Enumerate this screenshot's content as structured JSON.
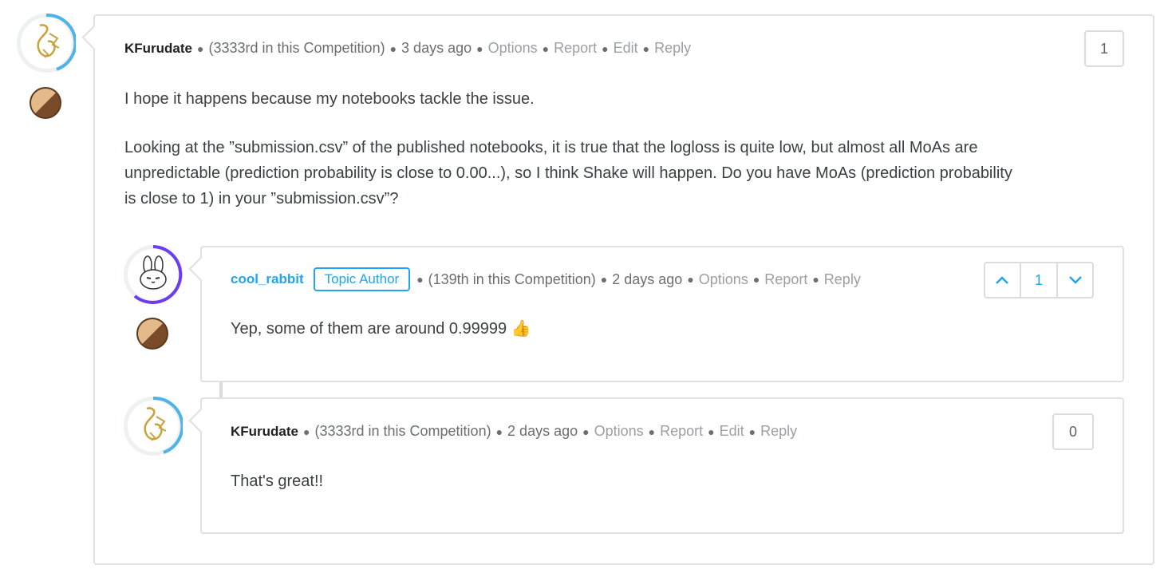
{
  "colors": {
    "accent": "#20a4f3",
    "ring_blue": "#4fb3ea",
    "ring_purple": "#6c3df0",
    "border": "#e0e0e0"
  },
  "comment_main": {
    "author": "KFurudate",
    "rank": "(3333rd in this Competition)",
    "time": "3 days ago",
    "actions": [
      "Options",
      "Report",
      "Edit",
      "Reply"
    ],
    "votes": "1",
    "paragraphs": [
      "I hope it happens because my notebooks tackle the issue.",
      "Looking at the ”submission.csv” of the published notebooks, it is true that the logloss is quite low, but almost all MoAs are",
      "unpredictable (prediction probability is close to 0.00...), so I think Shake will happen. Do you have MoAs (prediction probability",
      "is close to 1) in your ”submission.csv”?"
    ],
    "avatar_icon": "calligraphy-logo-icon",
    "tier_icon": "bronze-tier-icon"
  },
  "reply_1": {
    "author": "cool_rabbit",
    "badge": "Topic Author",
    "rank": "(139th in this Competition)",
    "time": "2 days ago",
    "actions": [
      "Options",
      "Report",
      "Reply"
    ],
    "votes": "1",
    "text": "Yep, some of them are around 0.99999 👍",
    "avatar_icon": "rabbit-avatar-icon",
    "upvote_icon": "chevron-up-icon",
    "downvote_icon": "chevron-down-icon"
  },
  "reply_2": {
    "author": "KFurudate",
    "rank": "(3333rd in this Competition)",
    "time": "2 days ago",
    "actions": [
      "Options",
      "Report",
      "Edit",
      "Reply"
    ],
    "votes": "0",
    "text": "That's great!!"
  }
}
